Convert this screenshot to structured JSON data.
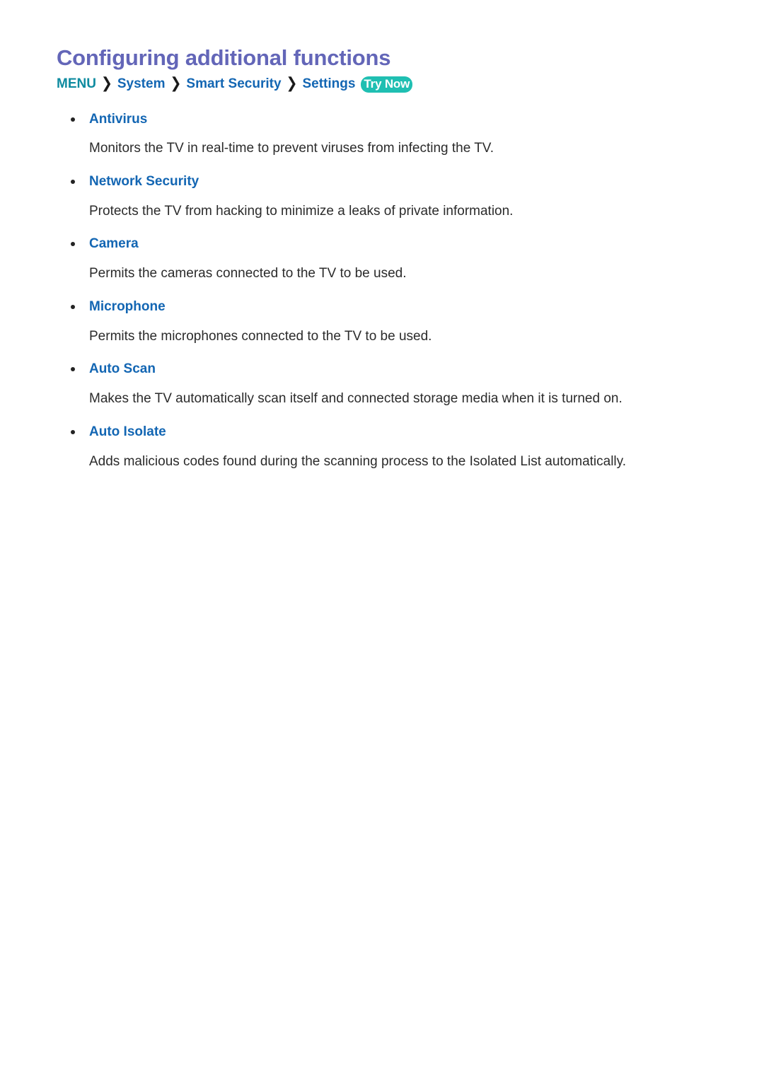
{
  "page": {
    "title": "Configuring additional functions"
  },
  "breadcrumb": {
    "root": "MENU",
    "separator": "❯",
    "items": [
      {
        "label": "System"
      },
      {
        "label": "Smart Security"
      },
      {
        "label": "Settings"
      }
    ],
    "badge": "Try Now"
  },
  "items": [
    {
      "heading": "Antivirus",
      "body": "Monitors the TV in real-time to prevent viruses from infecting the TV."
    },
    {
      "heading": "Network Security",
      "body": "Protects the TV from hacking to minimize a leaks of private information."
    },
    {
      "heading": "Camera",
      "body": "Permits the cameras connected to the TV to be used."
    },
    {
      "heading": "Microphone",
      "body": "Permits the microphones connected to the TV to be used."
    },
    {
      "heading": "Auto Scan",
      "body": "Makes the TV automatically scan itself and connected storage media when it is turned on."
    },
    {
      "heading": "Auto Isolate",
      "body": "Adds malicious codes found during the scanning process to the Isolated List automatically."
    }
  ],
  "colors": {
    "title": "#6366b8",
    "breadcrumb_root": "#0f8ba0",
    "breadcrumb_link": "#1366b3",
    "heading": "#1366b3",
    "body": "#2b2b2b",
    "badge_bg": "#1fbfb2",
    "badge_text": "#ffffff",
    "background": "#ffffff"
  }
}
